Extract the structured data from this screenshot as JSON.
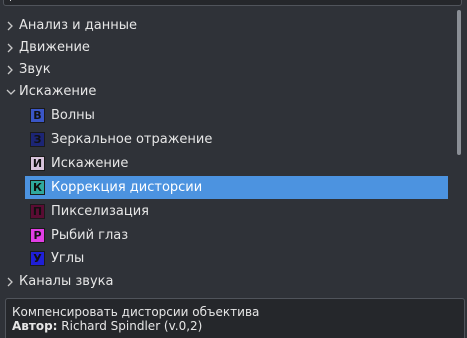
{
  "tree": {
    "categories_top": [
      {
        "label": "Анализ и данные",
        "expanded": false
      },
      {
        "label": "Движение",
        "expanded": false
      },
      {
        "label": "Звук",
        "expanded": false
      },
      {
        "label": "Искажение",
        "expanded": true
      }
    ],
    "items": [
      {
        "badge": "В",
        "badge_color": "#3a56c6",
        "badge_text_color": "#0d0d0d",
        "label": "Волны",
        "selected": false
      },
      {
        "badge": "З",
        "badge_color": "#1c2575",
        "badge_text_color": "#0d0d0d",
        "label": "Зеркальное отражение",
        "selected": false
      },
      {
        "badge": "И",
        "badge_color": "#d8c4dc",
        "badge_text_color": "#0d0d0d",
        "label": "Искажение",
        "selected": false
      },
      {
        "badge": "К",
        "badge_color": "#2fa89d",
        "badge_text_color": "#0d0d0d",
        "label": "Коррекция дисторсии",
        "selected": true
      },
      {
        "badge": "П",
        "badge_color": "#5a0c33",
        "badge_text_color": "#0d0d0d",
        "label": "Пикселизация",
        "selected": false
      },
      {
        "badge": "Р",
        "badge_color": "#e23ee5",
        "badge_text_color": "#0d0d0d",
        "label": "Рыбий глаз",
        "selected": false
      },
      {
        "badge": "У",
        "badge_color": "#1f1fd6",
        "badge_text_color": "#0d0d0d",
        "label": "Углы",
        "selected": false
      }
    ],
    "categories_bottom": [
      {
        "label": "Каналы звука",
        "expanded": false
      }
    ]
  },
  "description": {
    "text": "Компенсировать дисторсии объектива",
    "author_label": "Автор:",
    "author_value": "Richard Spindler (v.0,2)"
  },
  "colors": {
    "background": "#2f3238",
    "selection": "#4c93e0",
    "text": "#e6e6e6"
  }
}
